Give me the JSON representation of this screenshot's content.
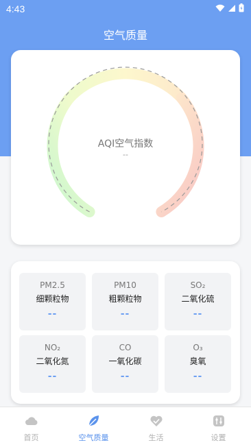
{
  "status_bar": {
    "time": "4:43"
  },
  "header": {
    "title": "空气质量"
  },
  "gauge": {
    "label": "AQI空气指数",
    "value": "--"
  },
  "pollutants": [
    {
      "code": "PM2.5",
      "name": "细颗粒物",
      "value": "--"
    },
    {
      "code": "PM10",
      "name": "粗颗粒物",
      "value": "--"
    },
    {
      "code": "SO₂",
      "name": "二氧化硫",
      "value": "--"
    },
    {
      "code": "NO₂",
      "name": "二氧化氮",
      "value": "--"
    },
    {
      "code": "CO",
      "name": "一氧化碳",
      "value": "--"
    },
    {
      "code": "O₃",
      "name": "臭氧",
      "value": "--"
    }
  ],
  "tabs": [
    {
      "label": "首页",
      "icon": "cloud-icon",
      "active": false
    },
    {
      "label": "空气质量",
      "icon": "leaf-icon",
      "active": true
    },
    {
      "label": "生活",
      "icon": "heart-icon",
      "active": false
    },
    {
      "label": "设置",
      "icon": "sliders-icon",
      "active": false
    }
  ],
  "colors": {
    "accent": "#6c9ff2",
    "active_tab": "#5b93ec",
    "gauge_green": "#c8f5c8",
    "gauge_yellow": "#fdf7cc",
    "gauge_red": "#f9c9c5"
  }
}
